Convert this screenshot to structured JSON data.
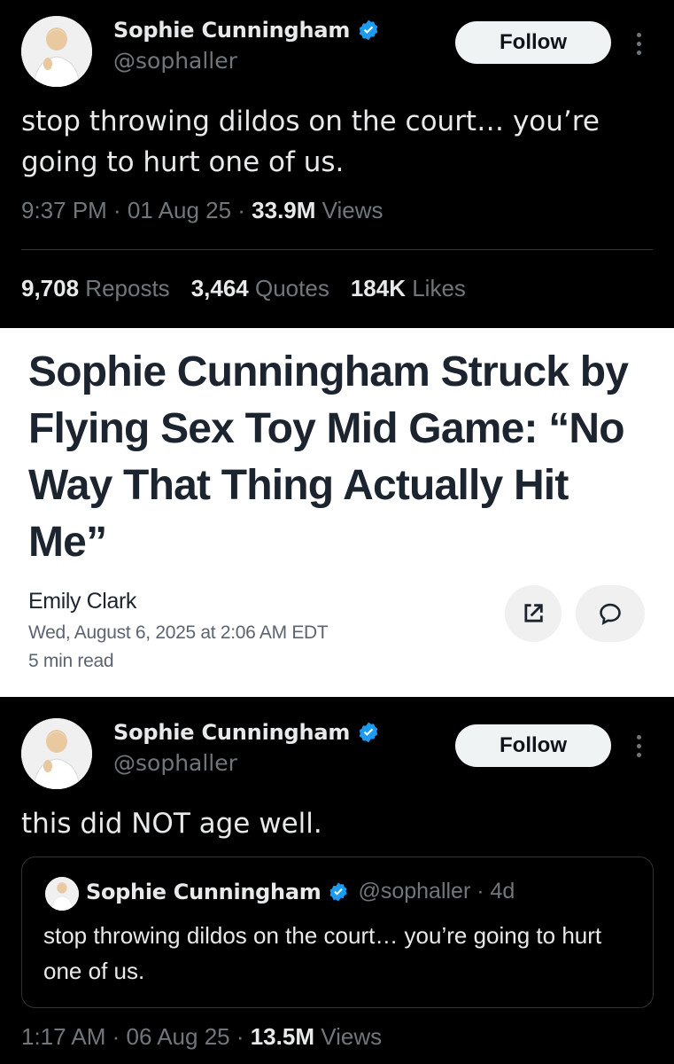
{
  "tweet1": {
    "author_name": "Sophie Cunningham",
    "handle": "@sophaller",
    "follow_label": "Follow",
    "text": "stop throwing dildos on the court… you’re\ngoing to hurt one of us.",
    "time": "9:37 PM · 01 Aug 25 · ",
    "views_count": "33.9M",
    "views_label": " Views",
    "reposts_count": "9,708",
    "reposts_label": " Reposts",
    "quotes_count": "3,464",
    "quotes_label": " Quotes",
    "likes_count": "184K",
    "likes_label": " Likes"
  },
  "article": {
    "headline": "Sophie Cunningham Struck by Flying Sex Toy Mid Game: “No Way That Thing Actually Hit Me”",
    "author": "Emily Clark",
    "date": "Wed, August 6, 2025 at 2:06 AM EDT",
    "read_time": "5 min read",
    "share_icon": "external-link-icon",
    "comment_icon": "comment-icon"
  },
  "tweet2": {
    "author_name": "Sophie Cunningham",
    "handle": "@sophaller",
    "follow_label": "Follow",
    "text": "this did NOT age well.",
    "time": "1:17 AM · 06 Aug 25 · ",
    "views_count": "13.5M",
    "views_label": " Views",
    "quote": {
      "author_name": "Sophie Cunningham",
      "handle_age": "@sophaller · 4d",
      "text": "stop throwing dildos on the court… you’re going to hurt one of us."
    }
  },
  "colors": {
    "background": "#000000",
    "article_bg": "#ffffff",
    "verified": "#1d9bf0",
    "muted": "#71767b"
  }
}
